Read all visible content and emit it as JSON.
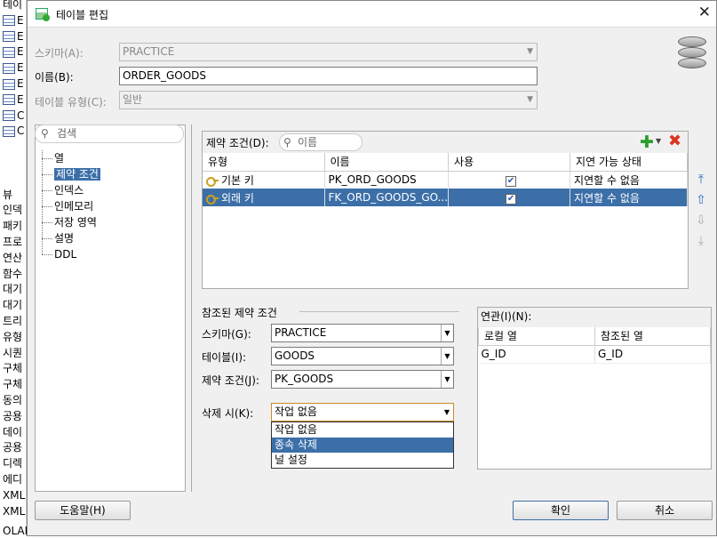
{
  "background": {
    "items": [
      "테이",
      "E",
      "E",
      "E",
      "E",
      "E",
      "E",
      "C",
      "C",
      "",
      "",
      "",
      "뷰",
      "인덱",
      "패키",
      "프로",
      "연산",
      "함수",
      "대기",
      "대기",
      "트리",
      "유형",
      "시퀀",
      "구체",
      "구체",
      "동의",
      "공용",
      "데이",
      "공용",
      "디렉",
      "에디",
      "XML",
      "XML"
    ],
    "footer": "OLAP 옵저"
  },
  "window": {
    "title": "테이블 편집",
    "close_glyph": "✕"
  },
  "form": {
    "schema_label": "스키마(A):",
    "schema_value": "PRACTICE",
    "name_label": "이름(B):",
    "name_value": "ORDER_GOODS",
    "type_label": "테이블 유형(C):",
    "type_value": "일반"
  },
  "nav": {
    "search_placeholder": "검색",
    "items": [
      "열",
      "제약 조건",
      "인덱스",
      "인메모리",
      "저장 영역",
      "설명",
      "DDL"
    ],
    "selected": 1
  },
  "constraints": {
    "label": "제약 조건(D):",
    "search_placeholder": "이름",
    "columns": [
      "유형",
      "이름",
      "사용",
      "지연 가능 상태"
    ],
    "rows": [
      {
        "type": "기본 키",
        "name": "PK_ORD_GOODS",
        "enabled": true,
        "deferrable": "지연할 수 없음"
      },
      {
        "type": "외래 키",
        "name": "FK_ORD_GOODS_GO...",
        "enabled": true,
        "deferrable": "지연할 수 없음"
      }
    ],
    "selected_row": 1
  },
  "referenced": {
    "title": "참조된 제약 조건",
    "schema_label": "스키마(G):",
    "schema_value": "PRACTICE",
    "table_label": "테이블(I):",
    "table_value": "GOODS",
    "constraint_label": "제약 조건(J):",
    "constraint_value": "PK_GOODS",
    "ondelete_label": "삭제 시(K):",
    "ondelete_value": "작업 없음",
    "ondelete_options": [
      "작업 없음",
      "종속 삭제",
      "널 설정"
    ],
    "highlighted_option": 1
  },
  "mapping": {
    "label": "연관(I)(N):",
    "columns": [
      "로컬 열",
      "참조된 열"
    ],
    "rows": [
      [
        "G_ID",
        "G_ID"
      ]
    ]
  },
  "buttons": {
    "help": "도움말(H)",
    "ok": "확인",
    "cancel": "취소"
  },
  "colors": {
    "selection": "#3c6fa8",
    "add": "#2a9d2a",
    "delete": "#d32222"
  }
}
